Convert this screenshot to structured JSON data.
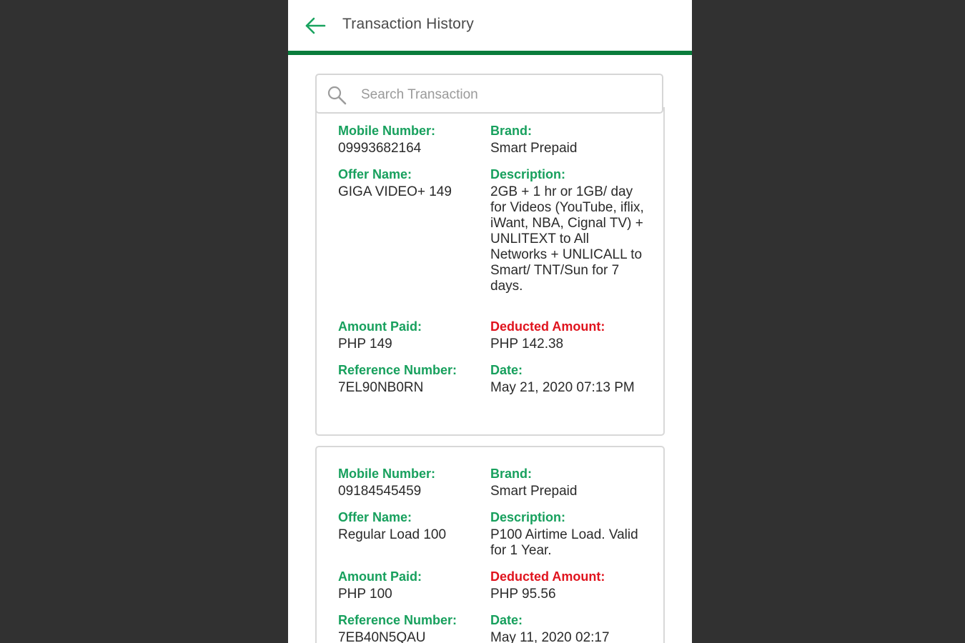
{
  "header": {
    "title": "Transaction History",
    "accent_color": "#0a7d3c",
    "back_icon": "arrow-left-icon"
  },
  "search": {
    "placeholder": "Search Transaction",
    "value": "",
    "icon": "search-icon"
  },
  "labels": {
    "mobile_number": "Mobile Number:",
    "brand": "Brand:",
    "offer_name": "Offer Name:",
    "description": "Description:",
    "amount_paid": "Amount Paid:",
    "deducted_amount": "Deducted Amount:",
    "reference_number": "Reference Number:",
    "date": "Date:"
  },
  "colors": {
    "label_green": "#17a05d",
    "label_red": "#e0141e"
  },
  "transactions": [
    {
      "mobile_number": "09993682164",
      "brand": "Smart Prepaid",
      "offer_name": "GIGA VIDEO+ 149",
      "description": "2GB + 1 hr or 1GB/ day for Videos (YouTube, iflix, iWant, NBA, Cignal TV) + UNLITEXT to All Networks + UNLICALL to Smart/ TNT/Sun for 7 days.",
      "amount_paid": "PHP 149",
      "deducted_amount": "PHP 142.38",
      "reference_number": "7EL90NB0RN",
      "date": "May 21, 2020 07:13 PM"
    },
    {
      "mobile_number": "09184545459",
      "brand": "Smart Prepaid",
      "offer_name": "Regular Load 100",
      "description": "P100 Airtime Load. Valid for 1 Year.",
      "amount_paid": "PHP 100",
      "deducted_amount": "PHP 95.56",
      "reference_number": "7EB40N5QAU",
      "date": "May 11, 2020 02:17"
    }
  ]
}
